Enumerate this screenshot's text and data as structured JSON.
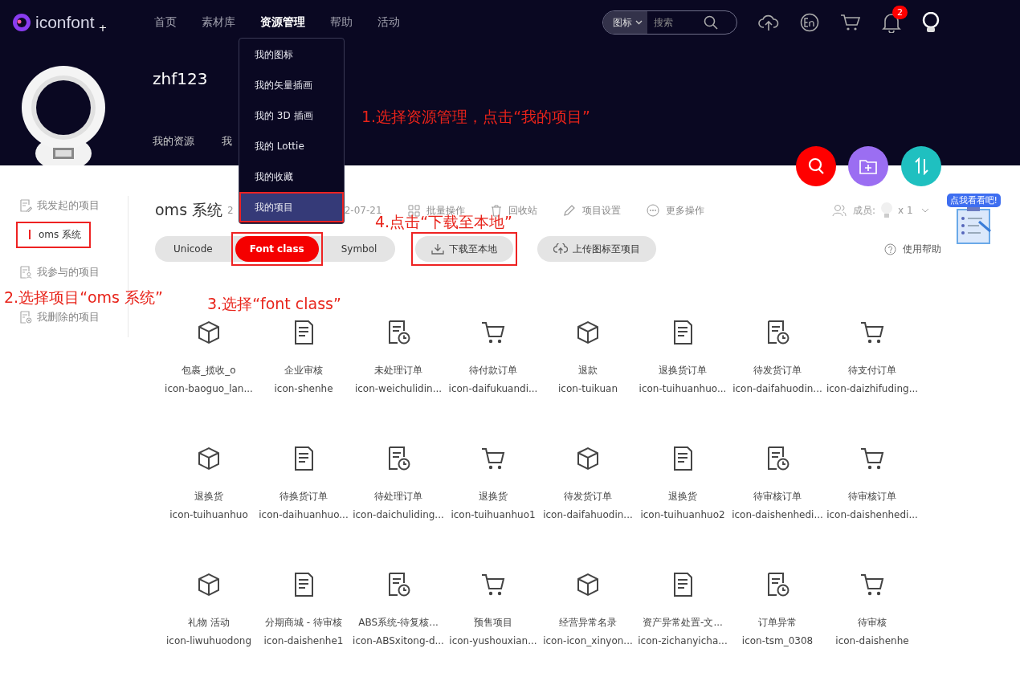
{
  "logo": {
    "text": "iconfont",
    "mark": "+"
  },
  "nav": [
    {
      "label": "首页",
      "selected": false
    },
    {
      "label": "素材库",
      "selected": false
    },
    {
      "label": "资源管理",
      "selected": true
    },
    {
      "label": "帮助",
      "selected": false
    },
    {
      "label": "活动",
      "selected": false
    }
  ],
  "search": {
    "scope": "图标",
    "placeholder": "搜索"
  },
  "notifications": {
    "count": "2"
  },
  "dropdown": [
    {
      "label": "我的图标",
      "selected": false,
      "highlighted": false
    },
    {
      "label": "我的矢量插画",
      "selected": false,
      "highlighted": false
    },
    {
      "label": "我的 3D 插画",
      "selected": false,
      "highlighted": false
    },
    {
      "label": "我的 Lottie",
      "selected": false,
      "highlighted": false
    },
    {
      "label": "我的收藏",
      "selected": false,
      "highlighted": false
    },
    {
      "label": "我的项目",
      "selected": true,
      "highlighted": true
    }
  ],
  "profile": {
    "username": "zhf123",
    "tabs": [
      {
        "label": "我的资源",
        "selected": false
      },
      {
        "label": "我",
        "selected": false
      }
    ]
  },
  "sidebar": [
    {
      "label": "我发起的项目",
      "children": [
        {
          "label": "oms 系统",
          "selected": true,
          "highlighted": true
        }
      ]
    },
    {
      "label": "我参与的项目"
    },
    {
      "label": "我删除的项目"
    }
  ],
  "project": {
    "title": "oms 系统",
    "date_parts": [
      "2",
      "2-07-21"
    ],
    "actions": [
      {
        "label": "批量操作"
      },
      {
        "label": "回收站"
      },
      {
        "label": "项目设置"
      },
      {
        "label": "更多操作"
      }
    ],
    "members_label": "成员:",
    "members_count": "x 1",
    "helper_badge": "点我看看吧!"
  },
  "format_tabs": [
    {
      "label": "Unicode",
      "selected": false,
      "highlighted": false
    },
    {
      "label": "Font class",
      "selected": true,
      "highlighted": true
    },
    {
      "label": "Symbol",
      "selected": false,
      "highlighted": false
    }
  ],
  "buttons": [
    {
      "label": "下载至本地",
      "highlighted": true
    },
    {
      "label": "上传图标至项目",
      "highlighted": false
    }
  ],
  "help": "使用帮助",
  "icons": [
    {
      "name": "包裹_揽收_o",
      "class": "icon-baoguo_lan..."
    },
    {
      "name": "企业审核",
      "class": "icon-shenhe"
    },
    {
      "name": "未处理订单",
      "class": "icon-weichulidin..."
    },
    {
      "name": "待付款订单",
      "class": "icon-daifukuandi..."
    },
    {
      "name": "退款",
      "class": "icon-tuikuan"
    },
    {
      "name": "退换货订单",
      "class": "icon-tuihuanhuo..."
    },
    {
      "name": "待发货订单",
      "class": "icon-daifahuodin..."
    },
    {
      "name": "待支付订单",
      "class": "icon-daizhifuding..."
    },
    {
      "name": "退换货",
      "class": "icon-tuihuanhuo"
    },
    {
      "name": "待换货订单",
      "class": "icon-daihuanhuo..."
    },
    {
      "name": "待处理订单",
      "class": "icon-daichuliding..."
    },
    {
      "name": "退换货",
      "class": "icon-tuihuanhuo1"
    },
    {
      "name": "待发货订单",
      "class": "icon-daifahuodin..."
    },
    {
      "name": "退换货",
      "class": "icon-tuihuanhuo2"
    },
    {
      "name": "待审核订单",
      "class": "icon-daishenhedi..."
    },
    {
      "name": "待审核订单",
      "class": "icon-daishenhedi..."
    },
    {
      "name": "礼物 活动",
      "class": "icon-liwuhuodong"
    },
    {
      "name": "分期商城 - 待审核",
      "class": "icon-daishenhe1"
    },
    {
      "name": "ABS系统-待复核...",
      "class": "icon-ABSxitong-d..."
    },
    {
      "name": "预售项目",
      "class": "icon-yushouxian..."
    },
    {
      "name": "经营异常名录",
      "class": "icon-icon_xinyon..."
    },
    {
      "name": "资产异常处置-文...",
      "class": "icon-zichanyicha..."
    },
    {
      "name": "订单异常",
      "class": "icon-tsm_0308"
    },
    {
      "name": "待审核",
      "class": "icon-daishenhe"
    }
  ],
  "annotations": [
    "1.选择资源管理，点击“我的项目”",
    "2.选择项目“oms 系统”",
    "3.选择“font class”",
    "4.点击“下载至本地”"
  ]
}
